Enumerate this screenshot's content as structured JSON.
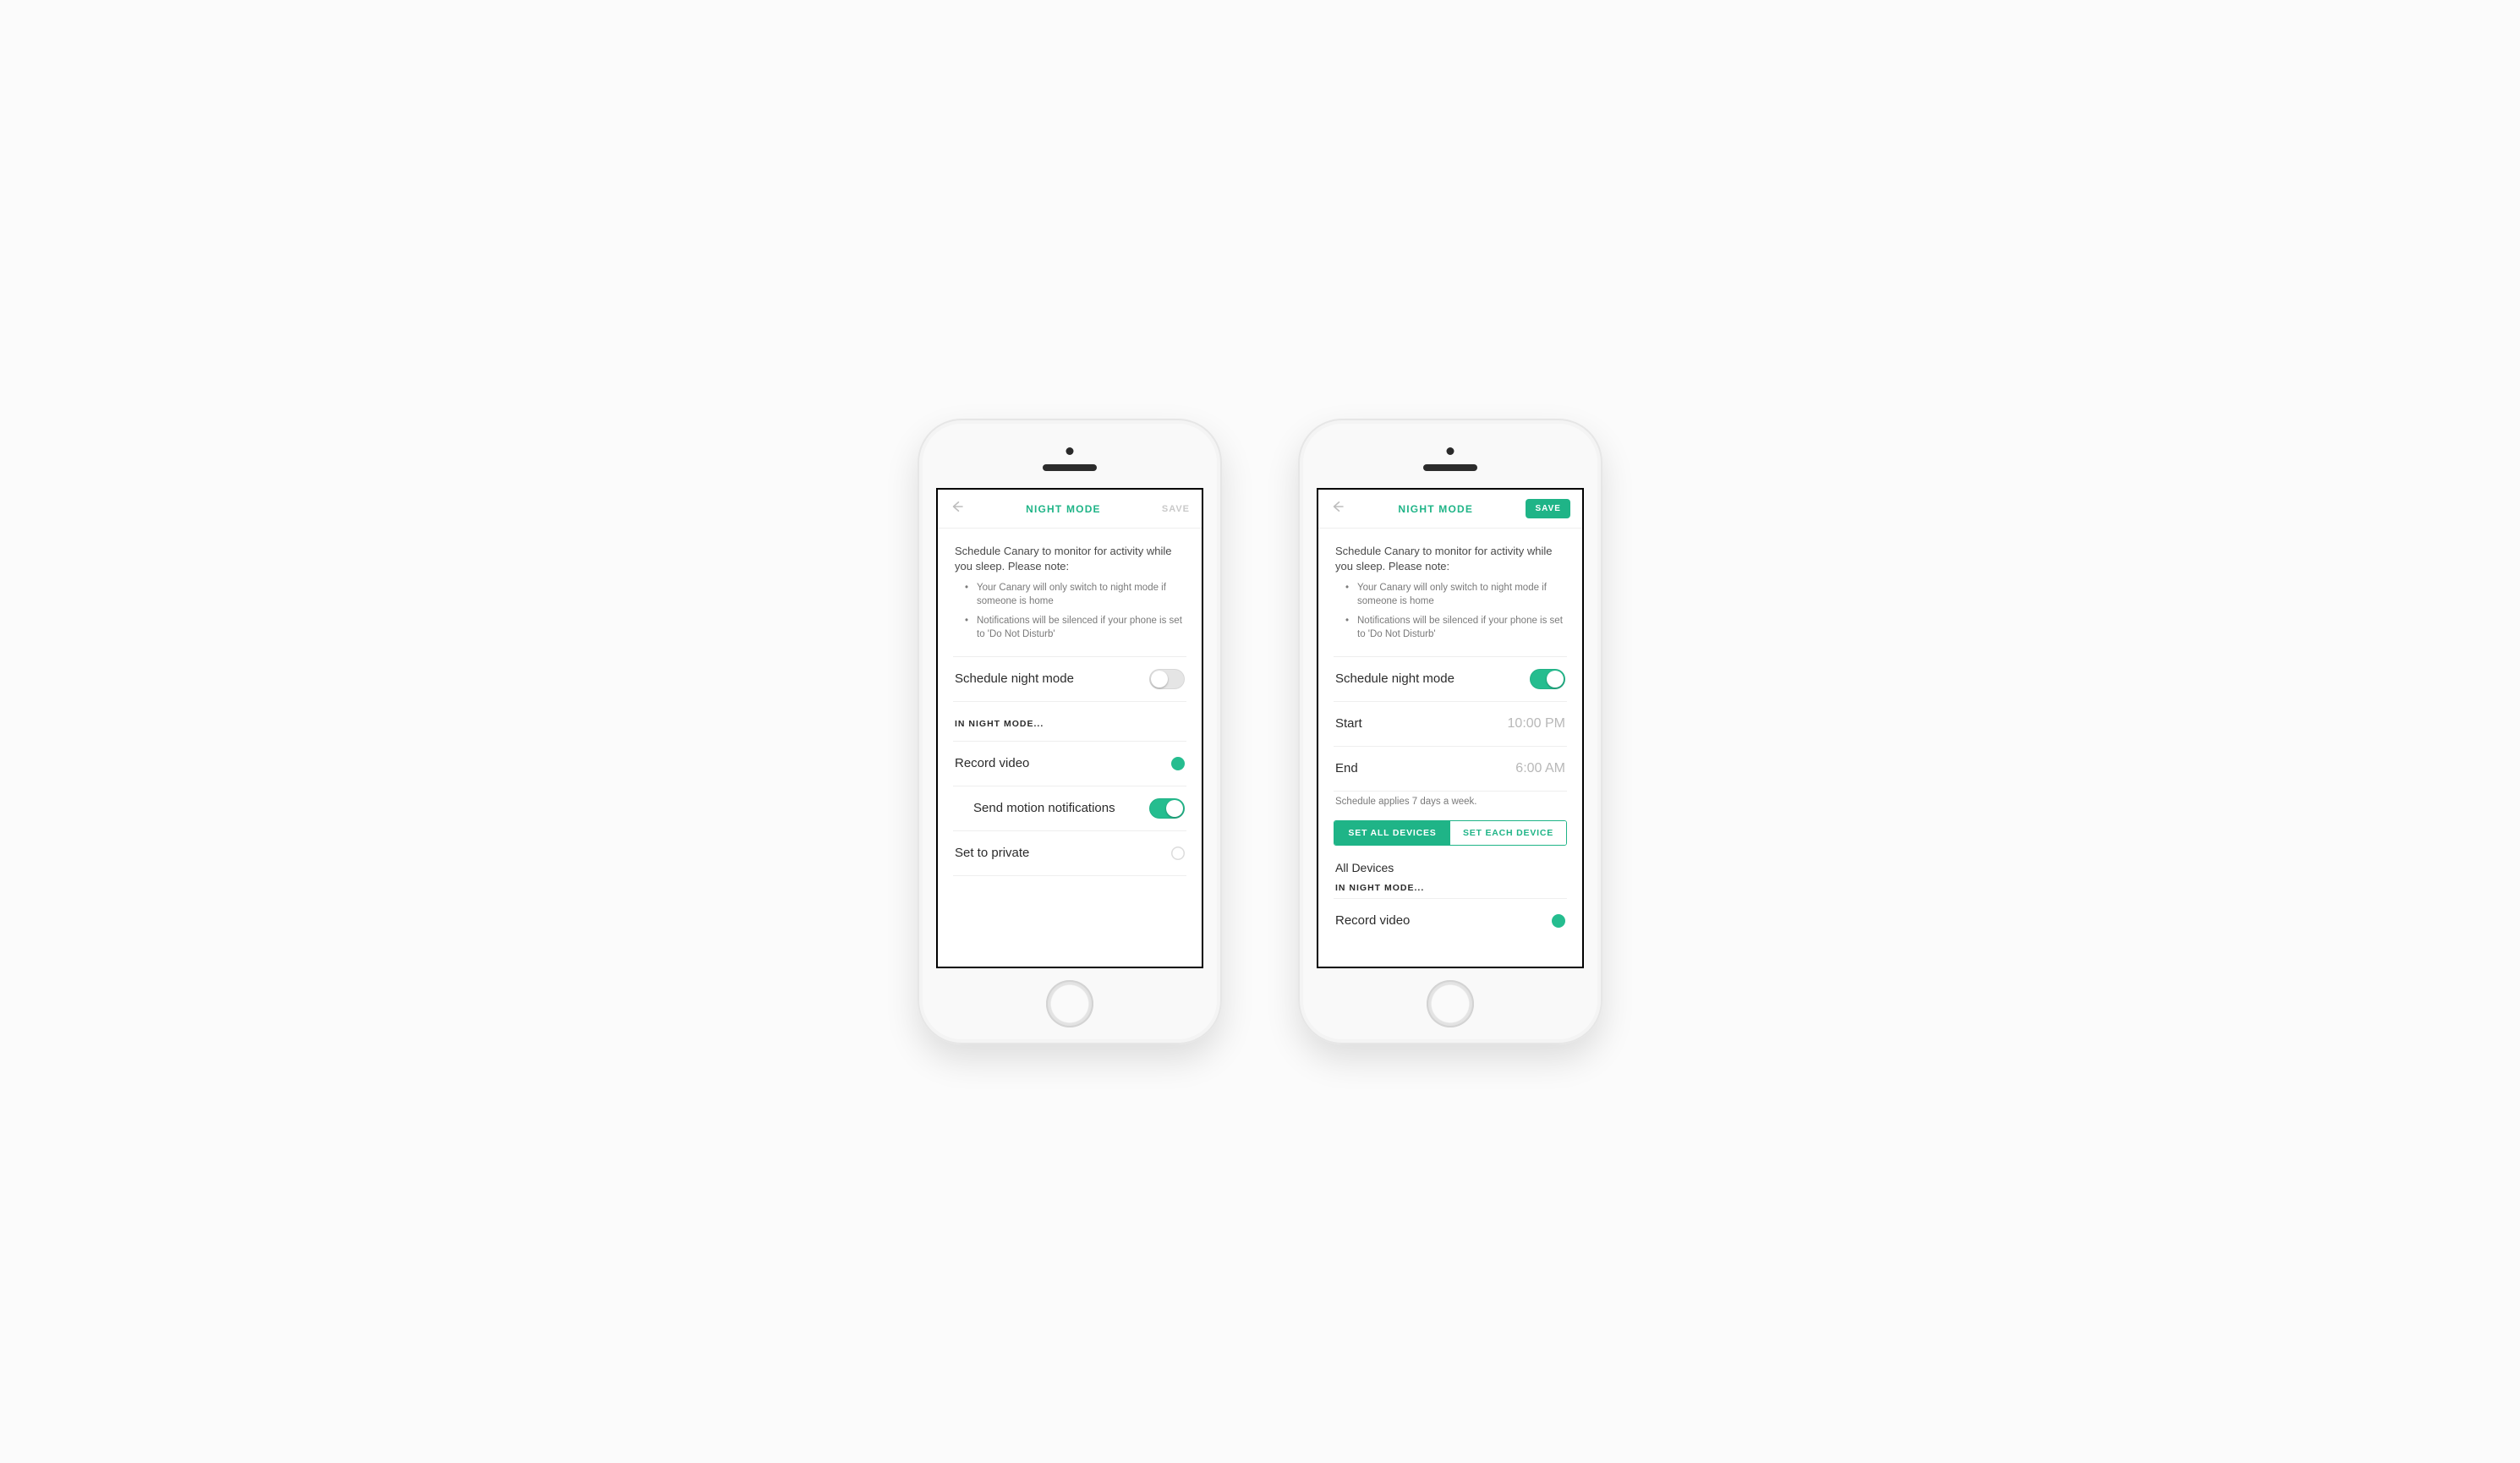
{
  "accent": "#1fb487",
  "navbar": {
    "title": "NIGHT MODE",
    "back_icon": "back-arrow",
    "save_label": "SAVE"
  },
  "intro": {
    "text": "Schedule Canary to monitor for activity while you sleep. Please note:",
    "bullets": [
      "Your Canary will only switch to night mode if someone is home",
      "Notifications will be silenced if your phone is set to 'Do Not Disturb'"
    ]
  },
  "rows": {
    "schedule_label": "Schedule night mode",
    "start_label": "Start",
    "end_label": "End",
    "record_label": "Record video",
    "motion_label": "Send motion notifications",
    "private_label": "Set to private"
  },
  "helper": {
    "schedule_note": "Schedule applies 7 days a week."
  },
  "section": {
    "in_night": "IN NIGHT MODE...",
    "all_devices": "All Devices"
  },
  "segmented": {
    "all": "SET ALL DEVICES",
    "each": "SET EACH DEVICE"
  },
  "phoneA": {
    "save_enabled": false,
    "schedule_on": false,
    "record_on": true,
    "motion_on": true,
    "private_on": false
  },
  "phoneB": {
    "save_enabled": true,
    "schedule_on": true,
    "start_value": "10:00 PM",
    "end_value": "6:00 AM",
    "segment_active": "all",
    "record_on": true
  }
}
